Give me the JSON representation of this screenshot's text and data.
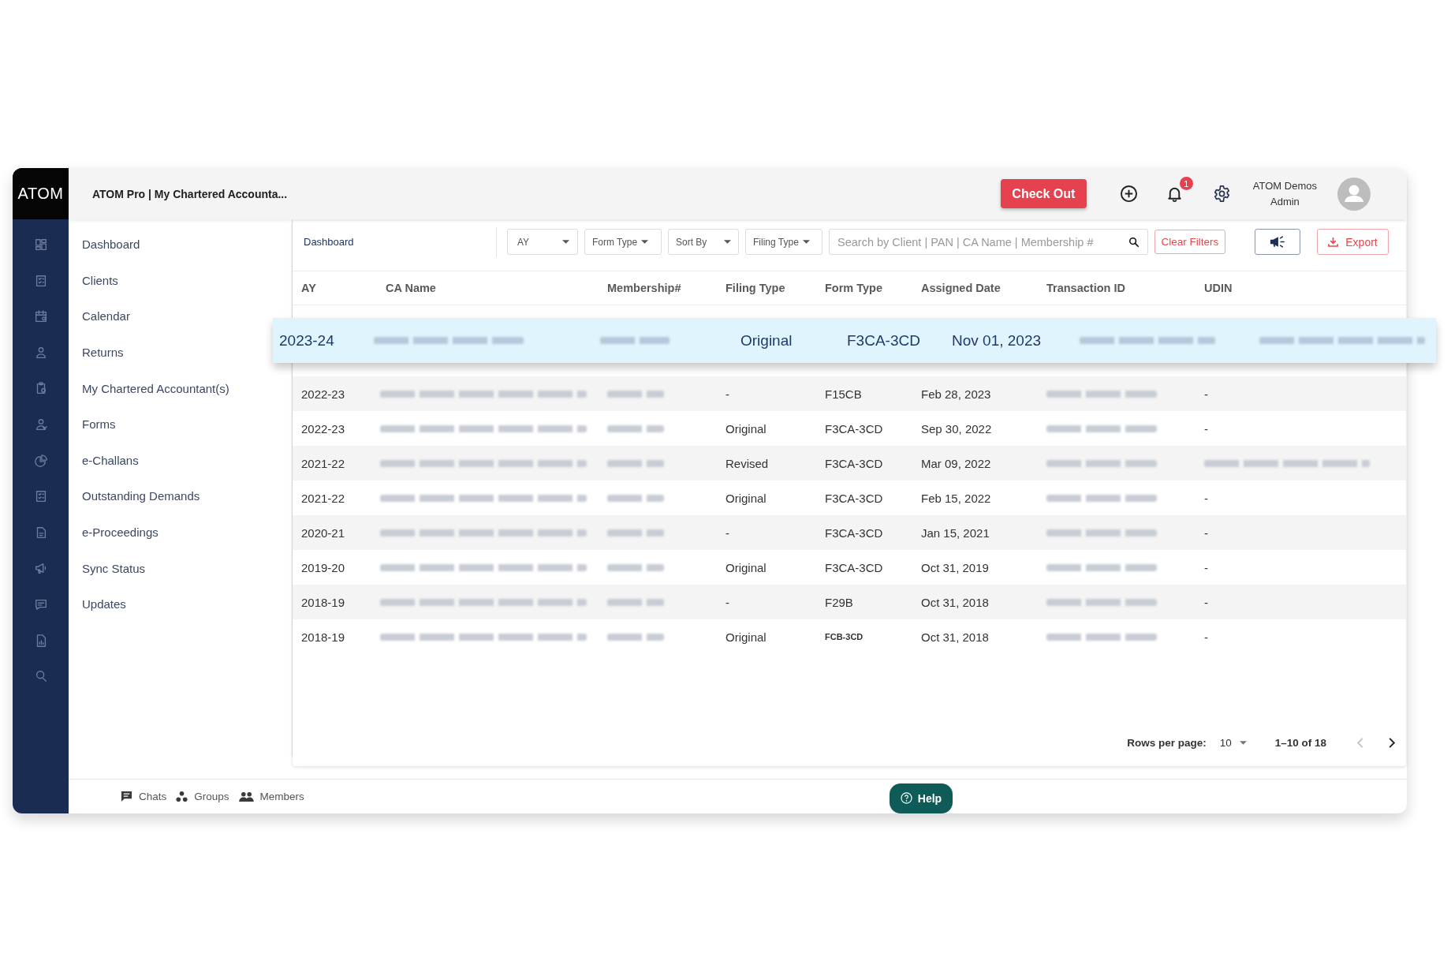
{
  "brand": {
    "logo": "ATOM"
  },
  "header": {
    "title": "ATOM Pro | My Chartered Accounta...",
    "check_out": "Check Out",
    "notification_count": "1",
    "user_name": "ATOM Demos",
    "user_role": "Admin"
  },
  "sidebar": {
    "items": [
      "Dashboard",
      "Clients",
      "Calendar",
      "Returns",
      "My Chartered Accountant(s)",
      "Forms",
      "e-Challans",
      "Outstanding Demands",
      "e-Proceedings",
      "Sync Status",
      "Updates"
    ]
  },
  "toolbar": {
    "breadcrumb": "Dashboard",
    "filters": [
      {
        "label": "AY"
      },
      {
        "label": "Form Type"
      },
      {
        "label": "Sort By"
      },
      {
        "label": "Filing Type"
      }
    ],
    "search": {
      "placeholder": "Search by Client | PAN | CA Name | Membership #"
    },
    "clear_filters": "Clear Filters",
    "export": "Export"
  },
  "table": {
    "columns": [
      "AY",
      "CA Name",
      "Membership#",
      "Filing Type",
      "Form Type",
      "Assigned Date",
      "Transaction ID",
      "UDIN"
    ],
    "rows": [
      {
        "ay": "2023-24",
        "filing_type": "Original",
        "form_type": "F3CA-3CD",
        "assigned_date": "Nov 01, 2023",
        "udin_blurred": true,
        "form_type_small": false,
        "selected": true
      },
      {
        "ay": "2022-23",
        "filing_type": "-",
        "form_type": "F15CB",
        "assigned_date": "Feb 28, 2023",
        "udin": "-",
        "udin_blurred": false,
        "form_type_small": false,
        "selected": false
      },
      {
        "ay": "2022-23",
        "filing_type": "Original",
        "form_type": "F3CA-3CD",
        "assigned_date": "Sep 30, 2022",
        "udin": "-",
        "udin_blurred": false,
        "form_type_small": false,
        "selected": false
      },
      {
        "ay": "2021-22",
        "filing_type": "Revised",
        "form_type": "F3CA-3CD",
        "assigned_date": "Mar 09, 2022",
        "udin_blurred": true,
        "form_type_small": false,
        "selected": false
      },
      {
        "ay": "2021-22",
        "filing_type": "Original",
        "form_type": "F3CA-3CD",
        "assigned_date": "Feb 15, 2022",
        "udin": "-",
        "udin_blurred": false,
        "form_type_small": false,
        "selected": false
      },
      {
        "ay": "2020-21",
        "filing_type": "-",
        "form_type": "F3CA-3CD",
        "assigned_date": "Jan 15, 2021",
        "udin": "-",
        "udin_blurred": false,
        "form_type_small": false,
        "selected": false
      },
      {
        "ay": "2019-20",
        "filing_type": "Original",
        "form_type": "F3CA-3CD",
        "assigned_date": "Oct 31, 2019",
        "udin": "-",
        "udin_blurred": false,
        "form_type_small": false,
        "selected": false
      },
      {
        "ay": "2018-19",
        "filing_type": "-",
        "form_type": "F29B",
        "assigned_date": "Oct 31, 2018",
        "udin": "-",
        "udin_blurred": false,
        "form_type_small": false,
        "selected": false
      },
      {
        "ay": "2018-19",
        "filing_type": "Original",
        "form_type": "FCB-3CD",
        "assigned_date": "Oct 31, 2018",
        "udin": "-",
        "udin_blurred": false,
        "form_type_small": true,
        "selected": false
      }
    ]
  },
  "pagination": {
    "label": "Rows per page:",
    "rows_per_page": "10",
    "range": "1–10 of 18",
    "prev": {
      "disabled": true
    },
    "next": {
      "disabled": false
    }
  },
  "footer": {
    "links": [
      {
        "label": "Chats"
      },
      {
        "label": "Groups"
      },
      {
        "label": "Members"
      }
    ],
    "help": "Help"
  }
}
